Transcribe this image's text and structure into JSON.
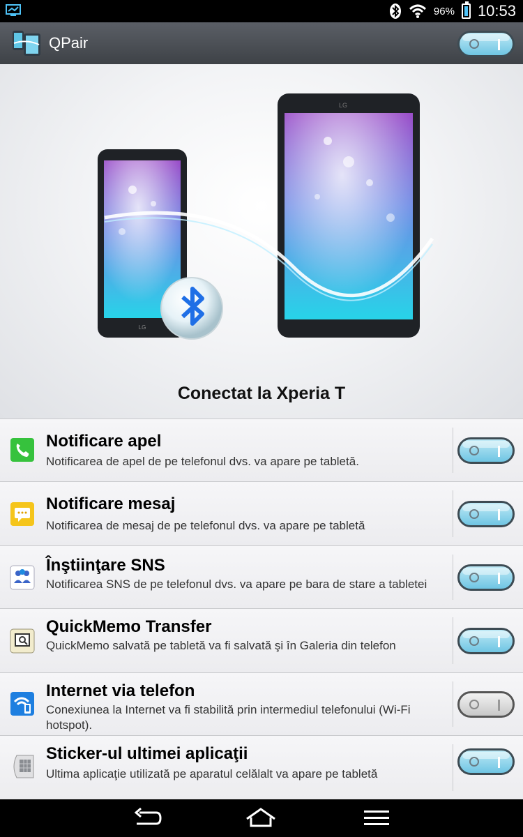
{
  "status_bar": {
    "left_icon": "screen-share-icon",
    "icons": [
      "bluetooth-icon",
      "wifi-icon"
    ],
    "battery_percent": "96%",
    "time": "10:53"
  },
  "app_bar": {
    "icon": "qpair-app-icon",
    "title": "QPair",
    "master_toggle": true
  },
  "hero": {
    "status_text": "Conectat la Xperia T"
  },
  "settings": [
    {
      "icon": "phone-call-icon",
      "title": "Notificare apel",
      "desc": "Notificarea de apel de pe telefonul dvs. va apare pe tabletă.",
      "on": true
    },
    {
      "icon": "message-icon",
      "title": "Notificare mesaj",
      "desc": "Notificarea de mesaj de pe telefonul dvs. va apare pe tabletă",
      "on": true
    },
    {
      "icon": "sns-icon",
      "title": "Înştiinţare SNS",
      "desc": "Notificarea SNS de pe telefonul dvs. va apare pe bara de stare a tabletei",
      "on": true
    },
    {
      "icon": "quickmemo-icon",
      "title": "QuickMemo Transfer",
      "desc": "QuickMemo salvată pe tabletă va fi salvată şi în Galeria din telefon",
      "on": true
    },
    {
      "icon": "wifi-hotspot-icon",
      "title": "Internet via telefon",
      "desc": "Conexiunea la Internet va fi stabilită prin intermediul telefonului (Wi-Fi hotspot).",
      "on": false
    },
    {
      "icon": "recent-app-sticker-icon",
      "title": "Sticker-ul ultimei aplicaţii",
      "desc": "Ultima aplicaţie utilizată pe aparatul celălalt va apare pe tabletă",
      "on": true
    }
  ],
  "nav": [
    "back-icon",
    "home-icon",
    "menu-icon"
  ]
}
